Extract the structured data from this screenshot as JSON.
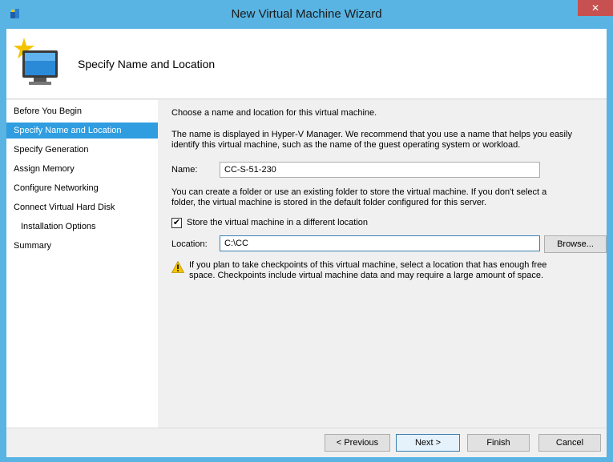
{
  "window": {
    "title": "New Virtual Machine Wizard",
    "close_glyph": "✕",
    "icons": {
      "app": "hyper-v-wizard-icon",
      "close": "close-icon"
    }
  },
  "header": {
    "heading": "Specify Name and Location",
    "icon": "new-virtual-machine-icon"
  },
  "sidebar": {
    "items": [
      {
        "label": "Before You Begin",
        "active": false
      },
      {
        "label": "Specify Name and Location",
        "active": true
      },
      {
        "label": "Specify Generation",
        "active": false
      },
      {
        "label": "Assign Memory",
        "active": false
      },
      {
        "label": "Configure Networking",
        "active": false
      },
      {
        "label": "Connect Virtual Hard Disk",
        "active": false
      },
      {
        "label": "Installation Options",
        "active": false,
        "sub": true
      },
      {
        "label": "Summary",
        "active": false
      }
    ]
  },
  "content": {
    "intro": "Choose a name and location for this virtual machine.",
    "name_help_1": "The name is displayed in Hyper-V Manager. We recommend that you use a name that helps you easily",
    "name_help_2": "identify this virtual machine, such as the name of the guest operating system or workload.",
    "name_label": "Name:",
    "name_value": "CC-S-51-230",
    "folder_help_1": "You can create a folder or use an existing folder to store the virtual machine. If you don't select a",
    "folder_help_2": "folder, the virtual machine is stored in the default folder configured for this server.",
    "store_checkbox_checked": true,
    "store_checkbox_glyph": "✔",
    "store_checkbox_label": "Store the virtual machine in a different location",
    "location_label": "Location:",
    "location_value": "C:\\CC",
    "browse_label": "Browse...",
    "warning_1": "If you plan to take checkpoints of this virtual machine, select a location that has enough free",
    "warning_2": "space. Checkpoints include virtual machine data and may require a large amount of space.",
    "warning_icon": "warning-icon"
  },
  "footer": {
    "previous_label": "< Previous",
    "next_label": "Next >",
    "finish_label": "Finish",
    "cancel_label": "Cancel"
  },
  "colors": {
    "title_bar": "#59b4e3",
    "close_button": "#c75050",
    "selected_item": "#2f9de0",
    "dialog_background": "#f0f0f0",
    "warning": "#f5c400"
  }
}
